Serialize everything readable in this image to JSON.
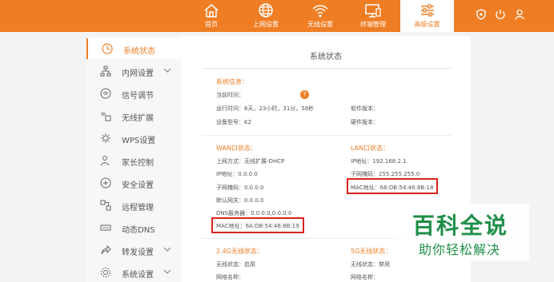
{
  "colors": {
    "accent": "#ef7d23",
    "highlight_box": "#d9241c",
    "watermark": "#1f8f48"
  },
  "nav": {
    "items": [
      {
        "label": "首页",
        "icon": "home-icon"
      },
      {
        "label": "上网设置",
        "icon": "globe-icon"
      },
      {
        "label": "无线设置",
        "icon": "wifi-icon"
      },
      {
        "label": "终端管理",
        "icon": "devices-icon"
      },
      {
        "label": "高级设置",
        "icon": "sliders-icon",
        "active": true
      }
    ],
    "right_icons": [
      "shield-icon",
      "power-icon",
      "user-icon"
    ]
  },
  "sidebar": {
    "items": [
      {
        "label": "系统状态",
        "icon": "clock-icon",
        "active": true
      },
      {
        "label": "内网设置",
        "icon": "network-icon",
        "expandable": true
      },
      {
        "label": "信号调节",
        "icon": "signal-icon"
      },
      {
        "label": "无线扩展",
        "icon": "extend-icon"
      },
      {
        "label": "WPS设置",
        "icon": "gear-icon"
      },
      {
        "label": "家长控制",
        "icon": "person-icon"
      },
      {
        "label": "安全设置",
        "icon": "plus-shield-icon"
      },
      {
        "label": "远程管理",
        "icon": "remote-icon"
      },
      {
        "label": "动态DNS",
        "icon": "dns-icon"
      },
      {
        "label": "转发设置",
        "icon": "share-icon",
        "expandable": true
      },
      {
        "label": "系统设置",
        "icon": "settings-icon",
        "expandable": true
      }
    ]
  },
  "main": {
    "title": "系统状态",
    "system": {
      "heading": "系统信息：",
      "current_time": "当前时间：",
      "help_badge": "?",
      "uptime": "运行时间：6天，23小时，31分，56秒",
      "software": "软件版本：",
      "model": "设备型号：K2",
      "hardware": "硬件版本："
    },
    "wan": {
      "heading": "WAN口状态：",
      "mode": "上网方式：无线扩展-DHCP",
      "ip": "IP地址：0.0.0.0",
      "mask": "子网掩码：0.0.0.0",
      "gateway": "默认网关：0.0.0.0",
      "dns": "DNS服务器：0.0.0.0,0.0.0.0",
      "mac": "MAC地址：6A:DB:54:46:8B:19"
    },
    "lan": {
      "heading": "LAN口状态：",
      "ip": "IP地址：192.168.2.1",
      "mask": "子网掩码：255.255.255.0",
      "mac": "MAC地址：68:DB:54:46:8B:18"
    },
    "wl24": {
      "heading": "2.4G无线状态：",
      "status": "无线状态：启用",
      "name": "网络名称："
    },
    "wl5": {
      "heading": "5G无线状态：",
      "status": "无线状态：禁用",
      "name": "网络名称："
    }
  },
  "watermark": {
    "title": "百科全说",
    "subtitle": "助你轻松解决"
  }
}
